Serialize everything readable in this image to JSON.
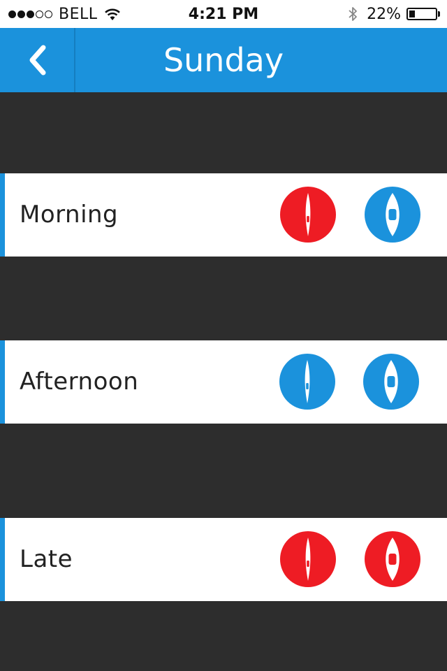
{
  "status_bar": {
    "signal_filled": 3,
    "signal_total": 5,
    "carrier": "BELL",
    "time": "4:21 PM",
    "battery_percent": "22%",
    "battery_level": 0.22
  },
  "nav": {
    "title": "Sunday",
    "back_icon": "chevron-left-icon"
  },
  "colors": {
    "brand_blue": "#1b92dc",
    "red": "#ee1c24",
    "background": "#2d2d2d"
  },
  "rows": [
    {
      "label": "Morning",
      "kayak_status": "red",
      "canoe_status": "blue"
    },
    {
      "label": "Afternoon",
      "kayak_status": "blue",
      "canoe_status": "blue"
    },
    {
      "label": "Late",
      "kayak_status": "red",
      "canoe_status": "red"
    }
  ],
  "icons": {
    "kayak": "kayak-icon",
    "canoe": "canoe-icon"
  }
}
